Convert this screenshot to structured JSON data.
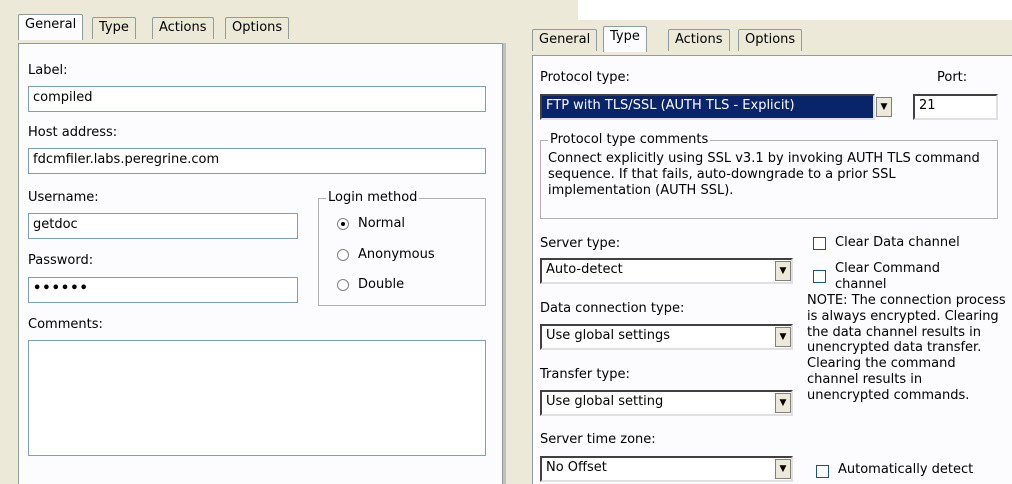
{
  "left": {
    "tabs": [
      "General",
      "Type",
      "Actions",
      "Options"
    ],
    "label_label": "Label:",
    "label_value": "compiled",
    "host_label": "Host address:",
    "host_value": "fdcmfiler.labs.peregrine.com",
    "username_label": "Username:",
    "username_value": "getdoc",
    "password_label": "Password:",
    "password_value": "••••••",
    "login_method_title": "Login method",
    "login_options": [
      "Normal",
      "Anonymous",
      "Double"
    ],
    "login_selected": "Normal",
    "comments_label": "Comments:",
    "comments_value": ""
  },
  "right": {
    "tabs": [
      "General",
      "Type",
      "Actions",
      "Options"
    ],
    "protocol_label": "Protocol type:",
    "protocol_value": "FTP with TLS/SSL (AUTH TLS - Explicit)",
    "port_label": "Port:",
    "port_value": "21",
    "protocol_comments_title": "Protocol type comments",
    "protocol_comments_text": "Connect explicitly using SSL v3.1 by invoking AUTH TLS command sequence. If that fails, auto-downgrade to a prior SSL implementation (AUTH SSL).",
    "server_type_label": "Server type:",
    "server_type_value": "Auto-detect",
    "data_conn_label": "Data connection type:",
    "data_conn_value": "Use global settings",
    "transfer_label": "Transfer type:",
    "transfer_value": "Use global setting",
    "timezone_label": "Server time zone:",
    "timezone_value": "No Offset",
    "clear_data_label": "Clear Data channel",
    "clear_command_label": "Clear Command channel",
    "note_text": "NOTE: The connection process is always encrypted.  Clearing the data channel results in unencrypted data transfer.  Clearing the command channel results in unencrypted commands.",
    "auto_detect_label": "Automatically detect"
  },
  "colors": {
    "selection": "#0a246a",
    "panel": "#ece9d8",
    "content": "#fcfcfe"
  }
}
